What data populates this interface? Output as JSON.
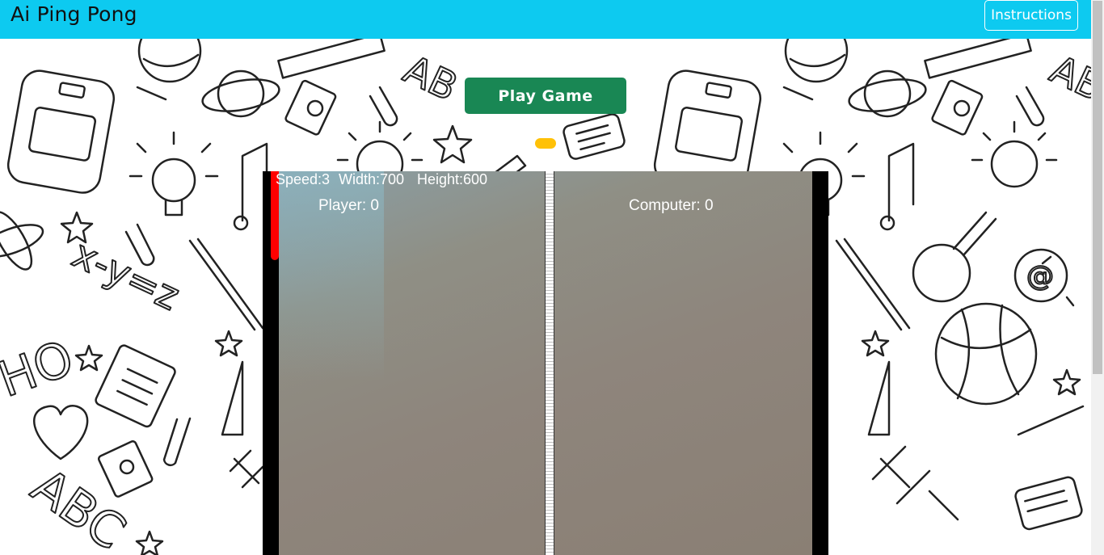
{
  "navbar": {
    "brand": "Ai Ping Pong",
    "instructions_label": "Instructions",
    "color": "#0dcaf0"
  },
  "controls": {
    "play_label": "Play Game",
    "play_color": "#198754",
    "loader_color": "#ffc107"
  },
  "game": {
    "speed_text": "Speed:3",
    "width_text": "Width:700",
    "height_text": "Height:600",
    "player_score_text": "Player: 0",
    "computer_score_text": "Computer: 0",
    "paddle_color": "#ff0000"
  },
  "background": {
    "pattern": "school doodles"
  }
}
